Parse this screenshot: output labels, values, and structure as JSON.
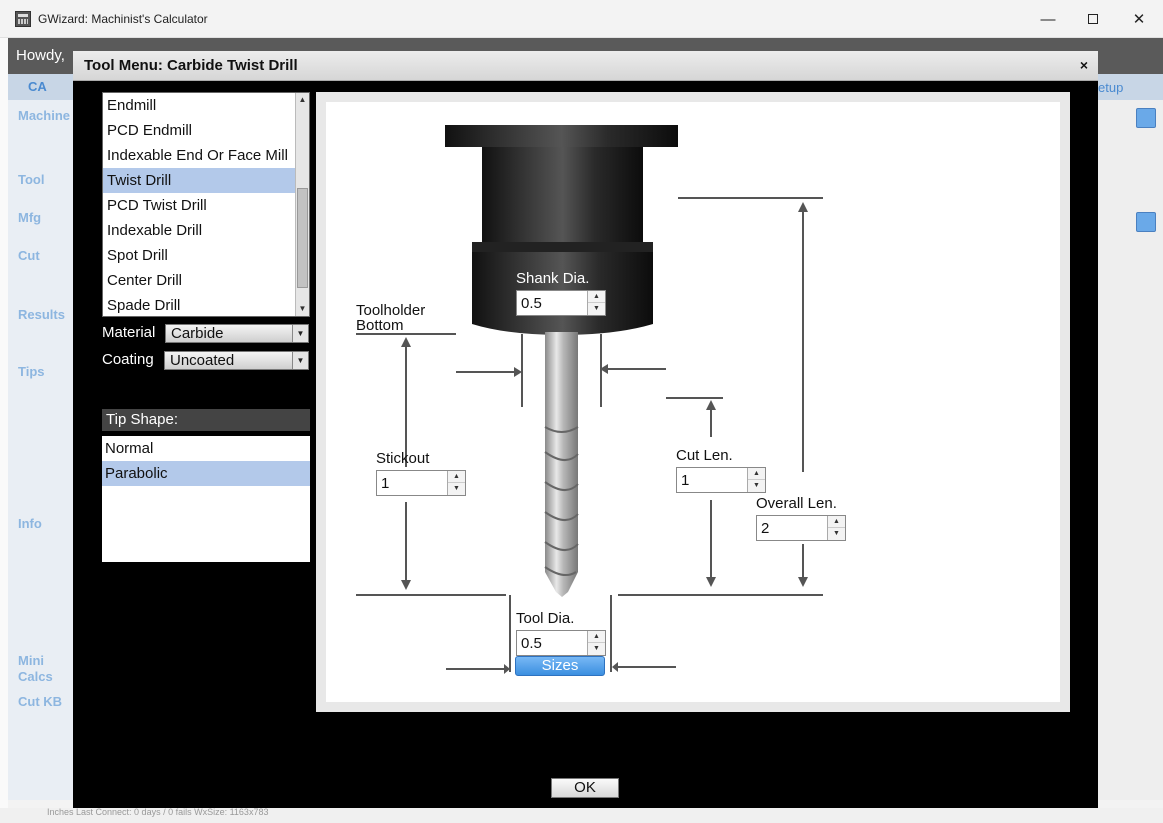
{
  "window": {
    "title": "GWizard: Machinist's Calculator",
    "minimize": "—",
    "close": "✕"
  },
  "background": {
    "howdy": "Howdy,",
    "tab_left": "CA",
    "tab_right": "etup",
    "sidebar": [
      "Machine",
      "Tool",
      "Mfg",
      "Cut",
      "Results",
      "Tips",
      "Info",
      "Mini Calcs",
      "Cut KB"
    ],
    "status": "Inches      Last Connect: 0 days / 0 fails     WxSize: 1163x783"
  },
  "dialog": {
    "title": "Tool Menu: Carbide Twist Drill",
    "close": "×",
    "tool_types": [
      "Endmill",
      "PCD Endmill",
      "Indexable End Or Face Mill",
      "Twist Drill",
      "PCD Twist Drill",
      "Indexable Drill",
      "Spot Drill",
      "Center Drill",
      "Spade Drill"
    ],
    "selected_tool": "Twist Drill",
    "material_label": "Material",
    "material_value": "Carbide",
    "coating_label": "Coating",
    "coating_value": "Uncoated",
    "tip_shape_label": "Tip Shape:",
    "tip_shapes": [
      "Normal",
      "Parabolic"
    ],
    "selected_tip": "Parabolic",
    "ok_label": "OK"
  },
  "diagram": {
    "shank_dia_label": "Shank Dia.",
    "shank_dia_value": "0.5",
    "toolholder_bottom_label_1": "Toolholder",
    "toolholder_bottom_label_2": "Bottom",
    "stickout_label": "Stickout",
    "stickout_value": "1",
    "cut_len_label": "Cut Len.",
    "cut_len_value": "1",
    "overall_len_label": "Overall Len.",
    "overall_len_value": "2",
    "tool_dia_label": "Tool Dia.",
    "tool_dia_value": "0.5",
    "sizes_label": "Sizes"
  }
}
